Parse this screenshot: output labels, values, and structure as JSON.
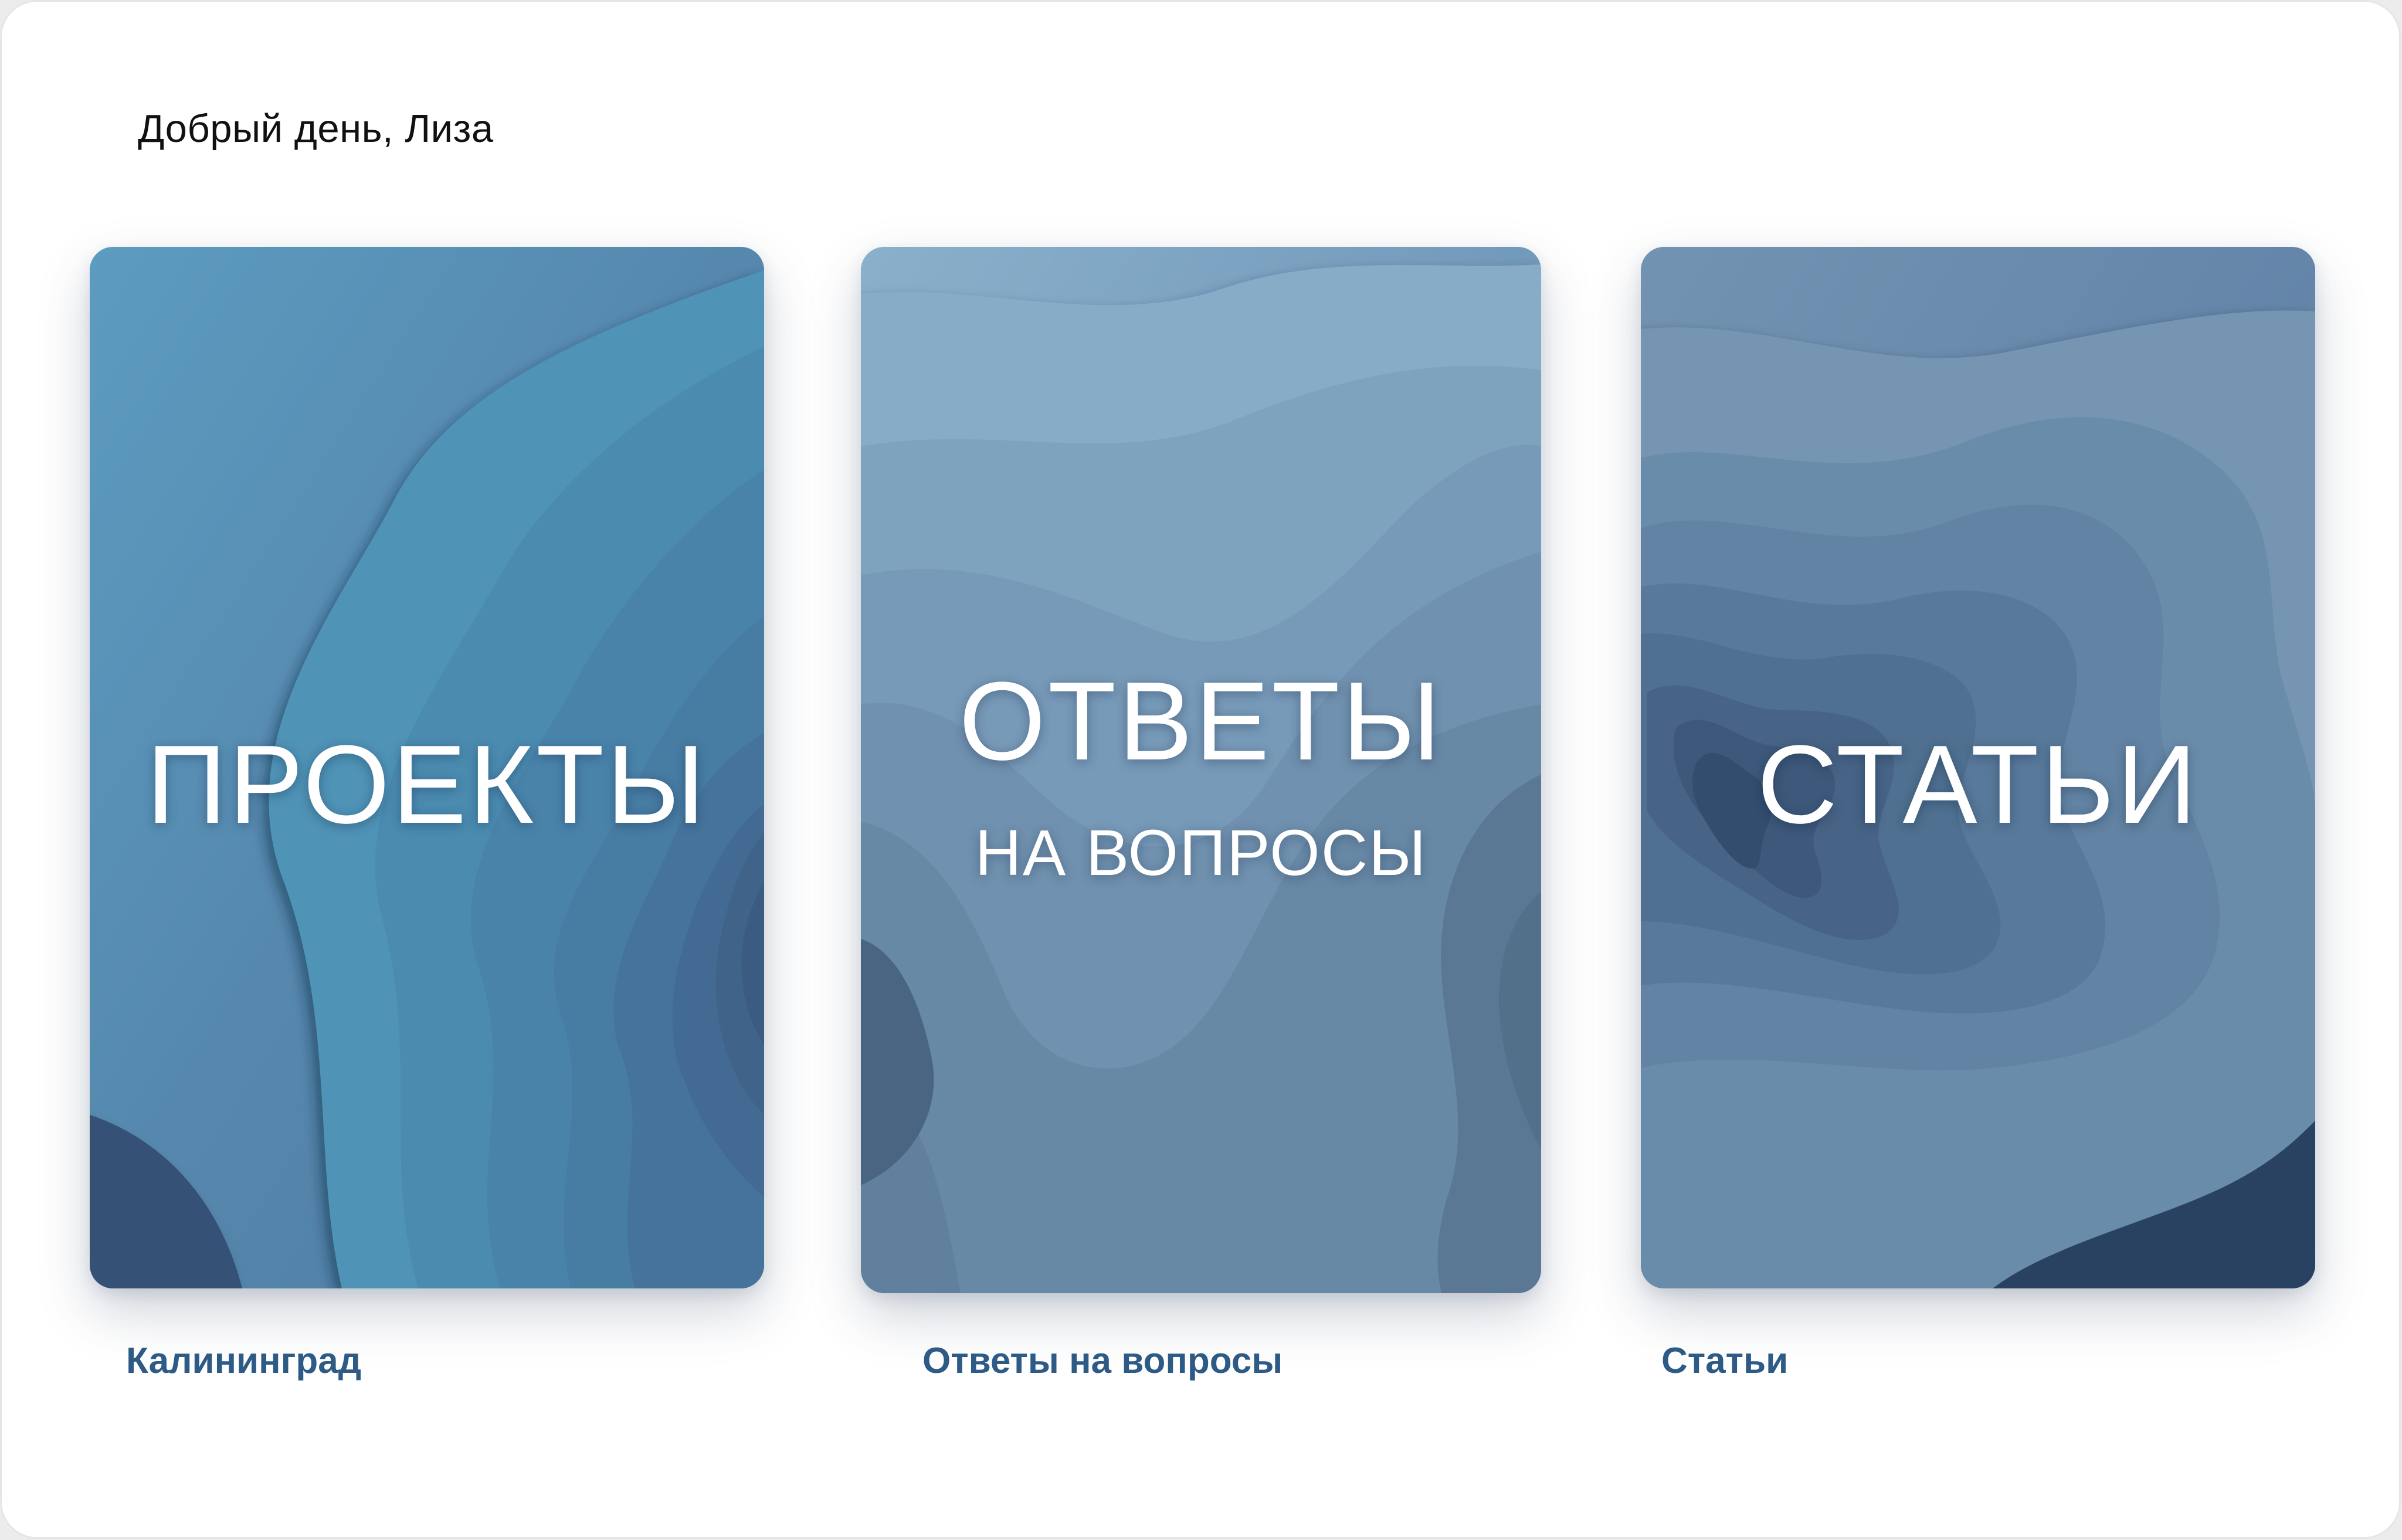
{
  "header": {
    "greeting": "Добрый день, Лиза"
  },
  "cards": [
    {
      "title": "ПРОЕКТЫ",
      "subtitle": "",
      "caption": "Калининград",
      "palette": [
        "#4f93b6",
        "#4c8bb0",
        "#4983aa",
        "#477ba3",
        "#45739b",
        "#426b93",
        "#3f6389",
        "#3b5b80",
        "#365175",
        "#2f4868"
      ]
    },
    {
      "title": "ОТВЕТЫ",
      "subtitle": "НА ВОПРОСЫ",
      "caption": "Ответы на вопросы",
      "palette": [
        "#86acc7",
        "#7ea3bf",
        "#779ab8",
        "#6f91af",
        "#6889a6",
        "#61809d",
        "#5a7894",
        "#526f8b",
        "#4a6581",
        "#405a75"
      ]
    },
    {
      "title": "СТАТЬИ",
      "subtitle": "",
      "caption": "Статьи",
      "palette": [
        "#7495b3",
        "#6a8cab",
        "#6283a3",
        "#59799a",
        "#506f90",
        "#476485",
        "#3d597a",
        "#334d6e",
        "#294262",
        "#1f3655"
      ]
    }
  ]
}
